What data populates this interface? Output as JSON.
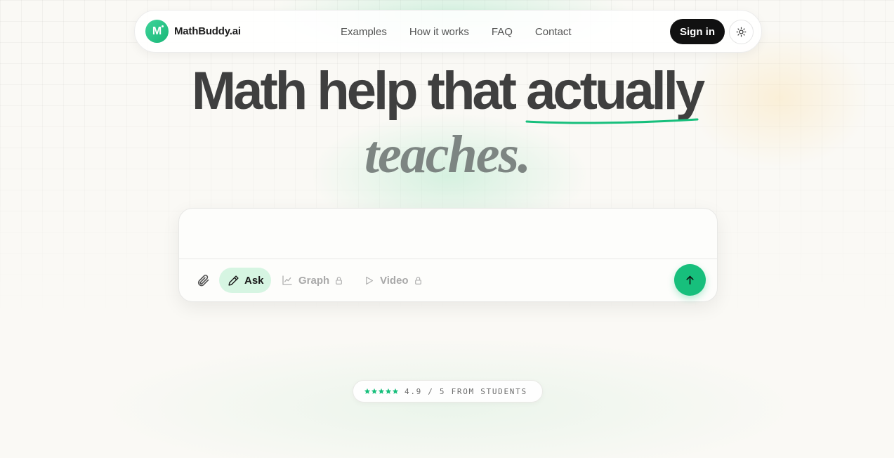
{
  "brand": {
    "logo_letter": "M",
    "name": "MathBuddy.ai",
    "accent": "#17bf7c"
  },
  "nav": {
    "links": [
      "Examples",
      "How it works",
      "FAQ",
      "Contact"
    ],
    "signin_label": "Sign in",
    "theme_icon": "sun-icon"
  },
  "hero": {
    "line1_prefix": "Math help that ",
    "line1_highlight": "actually",
    "line2": "teaches."
  },
  "composer": {
    "placeholder": "",
    "attach_icon": "paperclip-icon",
    "modes": [
      {
        "label": "Ask",
        "icon": "pencil-icon",
        "active": true,
        "locked": false
      },
      {
        "label": "Graph",
        "icon": "line-chart-icon",
        "active": false,
        "locked": true
      },
      {
        "label": "Video",
        "icon": "play-icon",
        "active": false,
        "locked": true
      }
    ],
    "send_icon": "arrow-up-icon"
  },
  "rating": {
    "stars": 5,
    "text": "4.9 / 5 FROM STUDENTS"
  }
}
